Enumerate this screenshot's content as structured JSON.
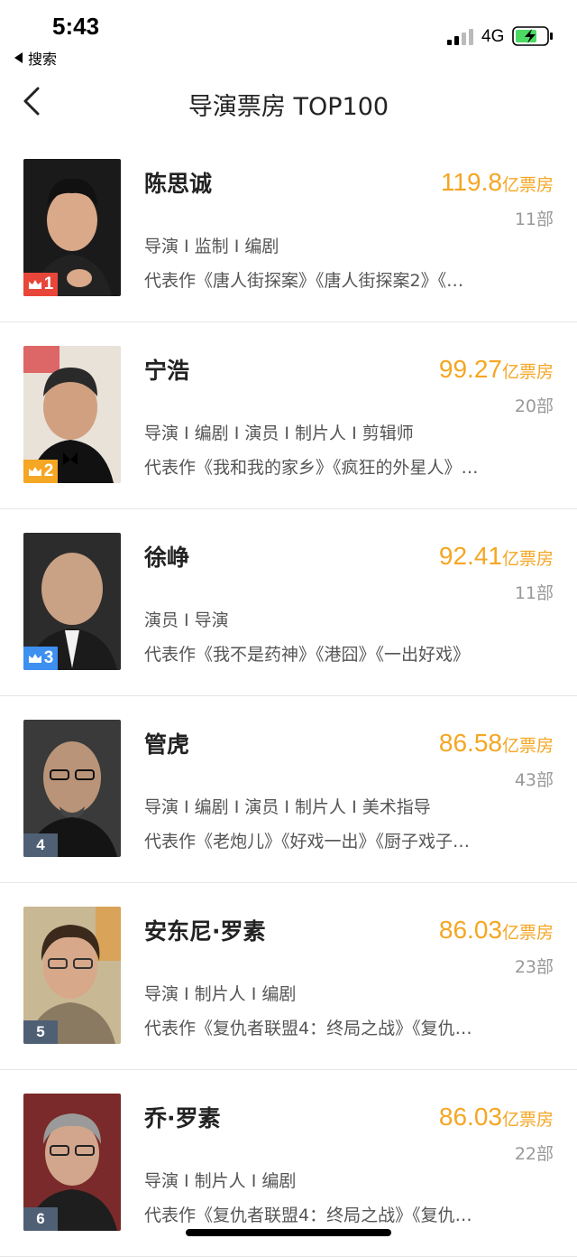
{
  "status": {
    "time": "5:43",
    "back_app": "搜索",
    "network": "4G"
  },
  "nav": {
    "title": "导演票房 TOP100"
  },
  "directors": [
    {
      "rank": "1",
      "name": "陈思诚",
      "box": "119.8",
      "unit": "亿票房",
      "count": "11部",
      "roles": "导演 I 监制 I 编剧",
      "works": "代表作《唐人街探案》《唐人街探案2》《…",
      "badge_color": "#e8463a"
    },
    {
      "rank": "2",
      "name": "宁浩",
      "box": "99.27",
      "unit": "亿票房",
      "count": "20部",
      "roles": "导演 I 编剧 I 演员 I 制片人 I 剪辑师",
      "works": "代表作《我和我的家乡》《疯狂的外星人》…",
      "badge_color": "#f5a623"
    },
    {
      "rank": "3",
      "name": "徐峥",
      "box": "92.41",
      "unit": "亿票房",
      "count": "11部",
      "roles": "演员 I 导演",
      "works": "代表作《我不是药神》《港囧》《一出好戏》",
      "badge_color": "#3d8ff0"
    },
    {
      "rank": "4",
      "name": "管虎",
      "box": "86.58",
      "unit": "亿票房",
      "count": "43部",
      "roles": "导演 I 编剧 I 演员 I 制片人 I 美术指导",
      "works": "代表作《老炮儿》《好戏一出》《厨子戏子…",
      "badge_color": "#4f6075"
    },
    {
      "rank": "5",
      "name": "安东尼·罗素",
      "box": "86.03",
      "unit": "亿票房",
      "count": "23部",
      "roles": "导演 I 制片人 I 编剧",
      "works": "代表作《复仇者联盟4：终局之战》《复仇…",
      "badge_color": "#4f6075"
    },
    {
      "rank": "6",
      "name": "乔·罗素",
      "box": "86.03",
      "unit": "亿票房",
      "count": "22部",
      "roles": "导演 I 制片人 I 编剧",
      "works": "代表作《复仇者联盟4：终局之战》《复仇…",
      "badge_color": "#4f6075"
    }
  ]
}
